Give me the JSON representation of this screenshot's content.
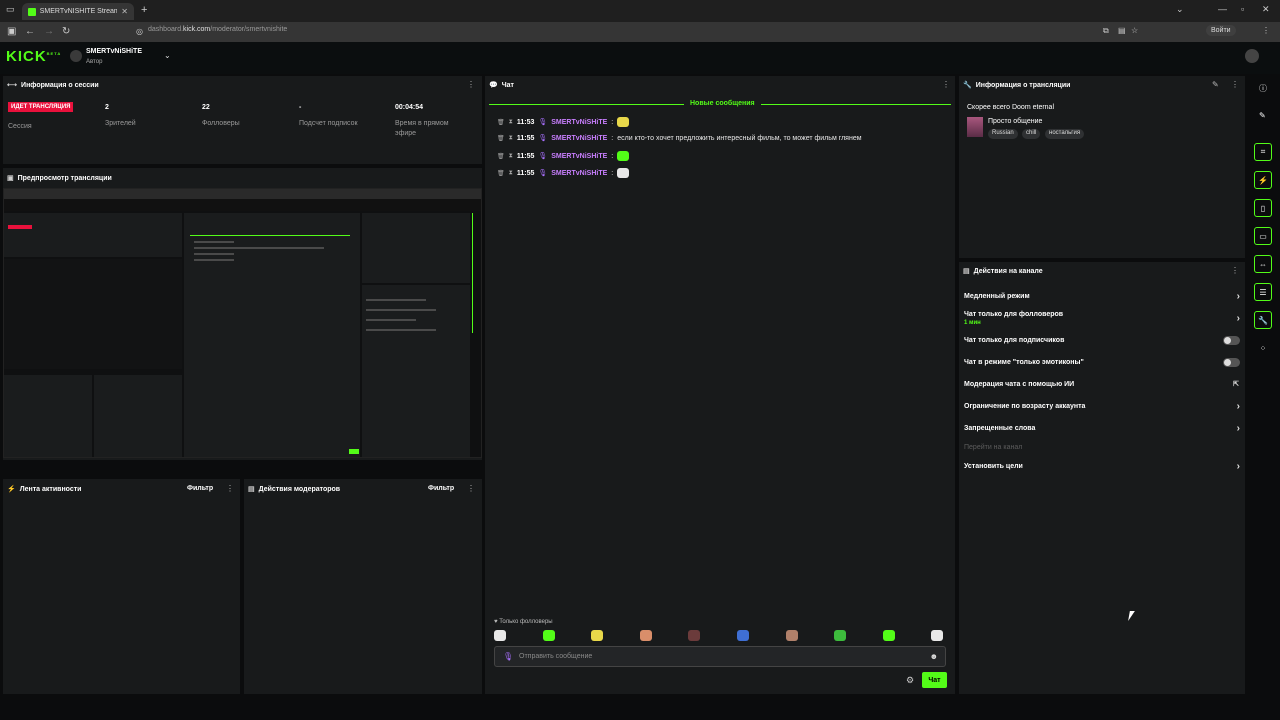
{
  "browser": {
    "tab_title": "SMERTvNISHITE Stream - K",
    "tab_close": "✕",
    "new_tab": "+",
    "url_prefix": "dashboard.",
    "url_domain": "kick.com",
    "url_path": "/moderator/smertvnishite",
    "login_label": "Войти"
  },
  "header": {
    "logo": "KICK",
    "logo_badge": "BETA",
    "channel_name": "SMERTvNiSHiTE",
    "channel_role": "Автор"
  },
  "session": {
    "title": "Информация о сессии",
    "live_badge": "ИДЕТ ТРАНСЛЯЦИЯ",
    "live_label": "Сессия",
    "stats": [
      {
        "value": "2",
        "label": "Зрителей"
      },
      {
        "value": "22",
        "label": "Фолловеры"
      },
      {
        "value": "-",
        "label": "Подсчет подписок"
      },
      {
        "value": "00:04:54",
        "label": "Время в прямом эфире"
      }
    ]
  },
  "preview": {
    "title": "Предпросмотр трансляции"
  },
  "activity": {
    "title": "Лента активности",
    "filter": "Фильтр"
  },
  "mod_actions": {
    "title": "Действия модераторов",
    "filter": "Фильтр"
  },
  "chat": {
    "title": "Чат",
    "new_messages": "Новые сообщения",
    "messages": [
      {
        "time": "11:53",
        "user": "SMERTvNiSHiTE",
        "text": "",
        "emote_color": "#e8d84a"
      },
      {
        "time": "11:55",
        "user": "SMERTvNiSHiTE",
        "text": "если кто-то хочет предложить интересный фильм, то может фильм глянем",
        "emote_color": ""
      },
      {
        "time": "11:55",
        "user": "SMERTvNiSHiTE",
        "text": "",
        "emote_color": "#53fc18"
      },
      {
        "time": "11:55",
        "user": "SMERTvNiSHiTE",
        "text": "",
        "emote_color": "#e8e8e8"
      }
    ],
    "followers_only": "Только фолловеры",
    "emotes": [
      "#e8e8e8",
      "#53fc18",
      "#e8d84a",
      "#d98e6a",
      "#6b3b3b",
      "#3f6fd4",
      "#b0806a",
      "#3dbb3d",
      "#53fc18",
      "#e8e8e8"
    ],
    "input_placeholder": "Отправить сообщение",
    "send_label": "Чат"
  },
  "stream_info": {
    "title": "Информация о трансляции",
    "stream_title": "Скорее всего Doom eternal",
    "category": "Просто общение",
    "tags": [
      "Russian",
      "chill",
      "ностальгия"
    ]
  },
  "channel_actions": {
    "title": "Действия на канале",
    "items": [
      {
        "label": "Медленный режим",
        "sub": "",
        "control": "chevron"
      },
      {
        "label": "Чат только для фолловеров",
        "sub": "1 мин",
        "control": "chevron"
      },
      {
        "label": "Чат только для подписчиков",
        "sub": "",
        "control": "toggle"
      },
      {
        "label": "Чат в режиме \"только эмотиконы\"",
        "sub": "",
        "control": "toggle"
      },
      {
        "label": "Модерация чата с помощью ИИ",
        "sub": "",
        "control": "external"
      },
      {
        "label": "Ограничение по возрасту аккаунта",
        "sub": "",
        "control": "chevron"
      },
      {
        "label": "Запрещенные слова",
        "sub": "",
        "control": "chevron"
      },
      {
        "label": "Перейти на канал",
        "sub": "",
        "control": "none"
      },
      {
        "label": "Установить цели",
        "sub": "",
        "control": "chevron"
      }
    ]
  },
  "colors": {
    "accent": "#53fc18",
    "live": "#e9113c",
    "username": "#c97fff",
    "panel": "#181a1b"
  },
  "icons": [
    "info-icon",
    "pencil-icon",
    "clip-icon",
    "lightning-icon",
    "bookmark-icon",
    "chat-icon",
    "raid-icon",
    "storage-icon",
    "wrench-icon",
    "apps-icon"
  ]
}
